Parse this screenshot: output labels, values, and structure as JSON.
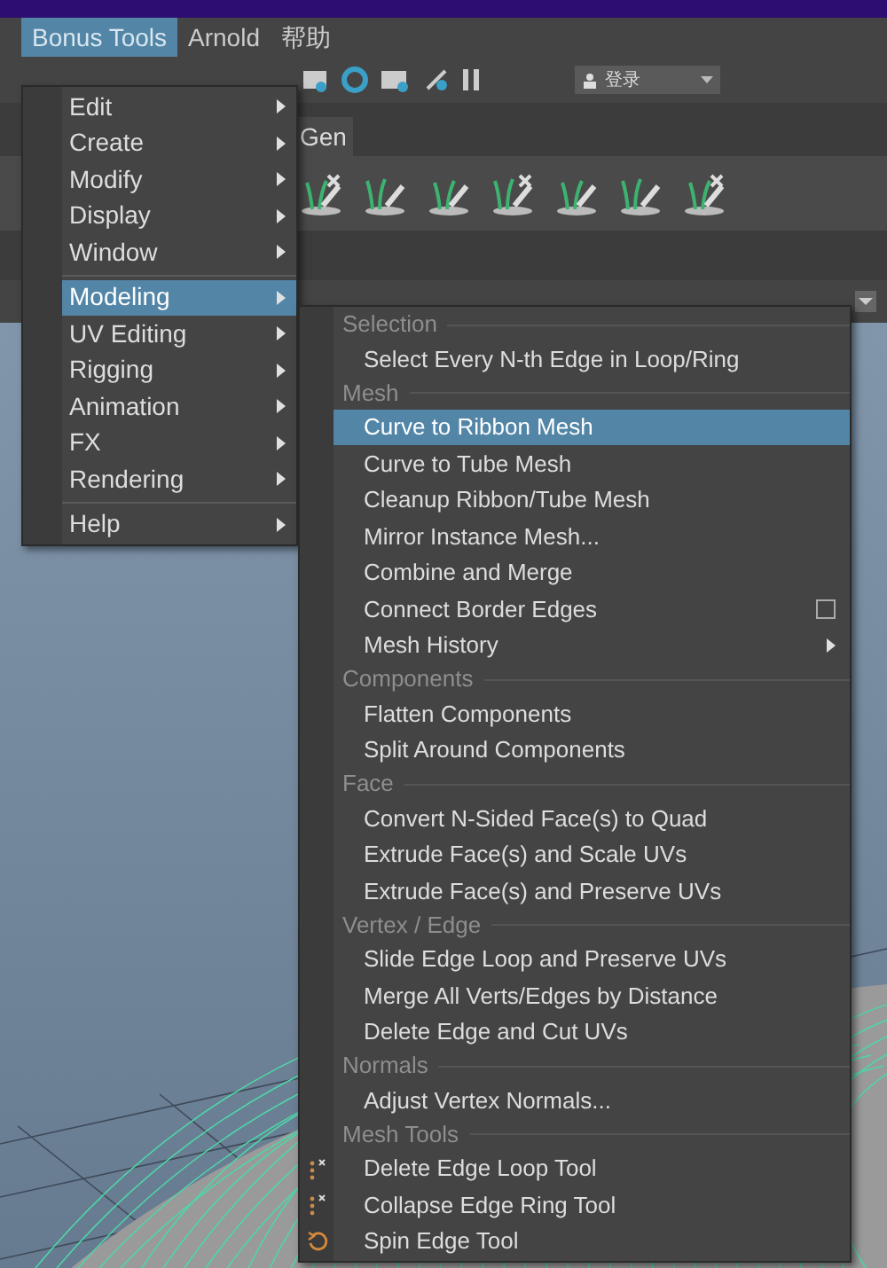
{
  "menubar": [
    {
      "label": "Bonus Tools",
      "selected": true
    },
    {
      "label": "Arnold",
      "selected": false
    },
    {
      "label": "帮助",
      "selected": false
    }
  ],
  "toolbar": {
    "login_dropdown": "登录"
  },
  "shelf": {
    "tabs": [
      {
        "label": "Gen",
        "selected": true
      }
    ]
  },
  "main_menu": [
    {
      "kind": "item",
      "label": "Edit",
      "selected": false
    },
    {
      "kind": "item",
      "label": "Create",
      "selected": false
    },
    {
      "kind": "item",
      "label": "Modify",
      "selected": false
    },
    {
      "kind": "item",
      "label": "Display",
      "selected": false
    },
    {
      "kind": "item",
      "label": "Window",
      "selected": false
    },
    {
      "kind": "separator"
    },
    {
      "kind": "item",
      "label": "Modeling",
      "selected": true
    },
    {
      "kind": "item",
      "label": "UV Editing",
      "selected": false
    },
    {
      "kind": "item",
      "label": "Rigging",
      "selected": false
    },
    {
      "kind": "item",
      "label": "Animation",
      "selected": false
    },
    {
      "kind": "item",
      "label": "FX",
      "selected": false
    },
    {
      "kind": "item",
      "label": "Rendering",
      "selected": false
    },
    {
      "kind": "separator"
    },
    {
      "kind": "item",
      "label": "Help",
      "selected": false
    }
  ],
  "submenu": [
    {
      "kind": "header",
      "label": "Selection"
    },
    {
      "kind": "item",
      "label": "Select Every N-th Edge in Loop/Ring",
      "selected": false
    },
    {
      "kind": "header",
      "label": "Mesh"
    },
    {
      "kind": "item",
      "label": "Curve to Ribbon Mesh",
      "selected": true
    },
    {
      "kind": "item",
      "label": "Curve to Tube Mesh",
      "selected": false
    },
    {
      "kind": "item",
      "label": "Cleanup Ribbon/Tube Mesh",
      "selected": false
    },
    {
      "kind": "item",
      "label": "Mirror Instance Mesh...",
      "selected": false
    },
    {
      "kind": "item",
      "label": "Combine and Merge",
      "selected": false
    },
    {
      "kind": "option",
      "label": "Connect Border Edges",
      "selected": false,
      "checked": false
    },
    {
      "kind": "submenu",
      "label": "Mesh History",
      "selected": false
    },
    {
      "kind": "header",
      "label": "Components"
    },
    {
      "kind": "item",
      "label": "Flatten Components",
      "selected": false
    },
    {
      "kind": "item",
      "label": "Split Around Components",
      "selected": false
    },
    {
      "kind": "header",
      "label": "Face"
    },
    {
      "kind": "item",
      "label": "Convert N-Sided Face(s) to Quad",
      "selected": false
    },
    {
      "kind": "item",
      "label": "Extrude Face(s) and Scale UVs",
      "selected": false
    },
    {
      "kind": "item",
      "label": "Extrude Face(s) and Preserve UVs",
      "selected": false
    },
    {
      "kind": "header",
      "label": "Vertex / Edge"
    },
    {
      "kind": "item",
      "label": "Slide Edge Loop and Preserve UVs",
      "selected": false
    },
    {
      "kind": "item",
      "label": "Merge All Verts/Edges by Distance",
      "selected": false
    },
    {
      "kind": "item",
      "label": "Delete Edge and Cut UVs",
      "selected": false
    },
    {
      "kind": "header",
      "label": "Normals"
    },
    {
      "kind": "item",
      "label": "Adjust Vertex Normals...",
      "selected": false
    },
    {
      "kind": "header",
      "label": "Mesh Tools"
    },
    {
      "kind": "tool",
      "label": "Delete Edge Loop Tool",
      "selected": false
    },
    {
      "kind": "tool",
      "label": "Collapse Edge Ring Tool",
      "selected": false
    },
    {
      "kind": "tool",
      "label": "Spin Edge Tool",
      "selected": false
    }
  ]
}
